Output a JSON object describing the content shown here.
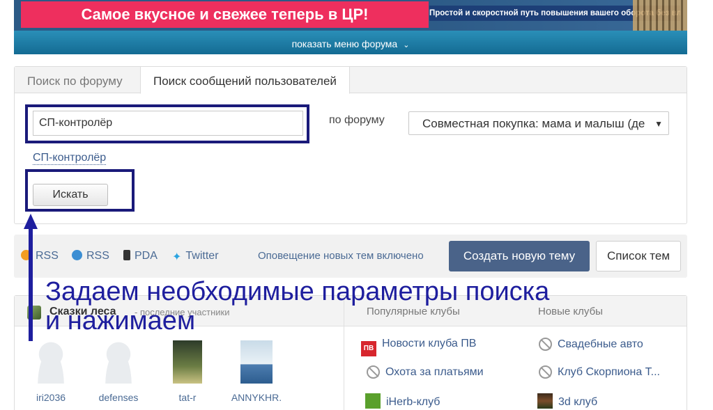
{
  "banner": {
    "ad_left": "Самое вкусное и свежее теперь в ЦР!",
    "ad_right": "Простой и скоростной путь повышения вашего оборота без вложений!",
    "menu_label": "показать меню форума"
  },
  "search": {
    "tab_forum": "Поиск по форуму",
    "tab_users": "Поиск сообщений пользователей",
    "input_value": "СП-контролёр",
    "forum_label": "по форуму",
    "forum_select": "Совместная покупка: мама и малыш (де",
    "suggestion": "СП-контролёр",
    "button": "Искать"
  },
  "links": {
    "rss1": "RSS",
    "rss2": "RSS",
    "pda": "PDA",
    "twitter": "Twitter",
    "notify": "Оповещение новых тем включено",
    "create": "Создать новую тему",
    "list": "Список тем"
  },
  "forest": {
    "title": "Сказки леса",
    "subtitle": "- последние участники",
    "members": [
      "iri2036",
      "defenses",
      "tat-r",
      "ANNYKHR."
    ]
  },
  "popular": {
    "heading": "Популярные клубы",
    "items": [
      "Новости клуба ПВ",
      "Охота за платьями",
      "iHerb-клуб"
    ]
  },
  "new_clubs": {
    "heading": "Новые клубы",
    "items": [
      "Свадебные авто",
      "Клуб Скорпиона Т...",
      "3d клуб"
    ]
  },
  "annotation": {
    "line1": "Задаем необходимые параметры поиска",
    "line2": "и нажимаем"
  },
  "colors": {
    "annotation": "#1e1e9e",
    "highlight_box": "#1a1a7a",
    "create_button": "#4a6389",
    "link": "#4a6a94"
  }
}
